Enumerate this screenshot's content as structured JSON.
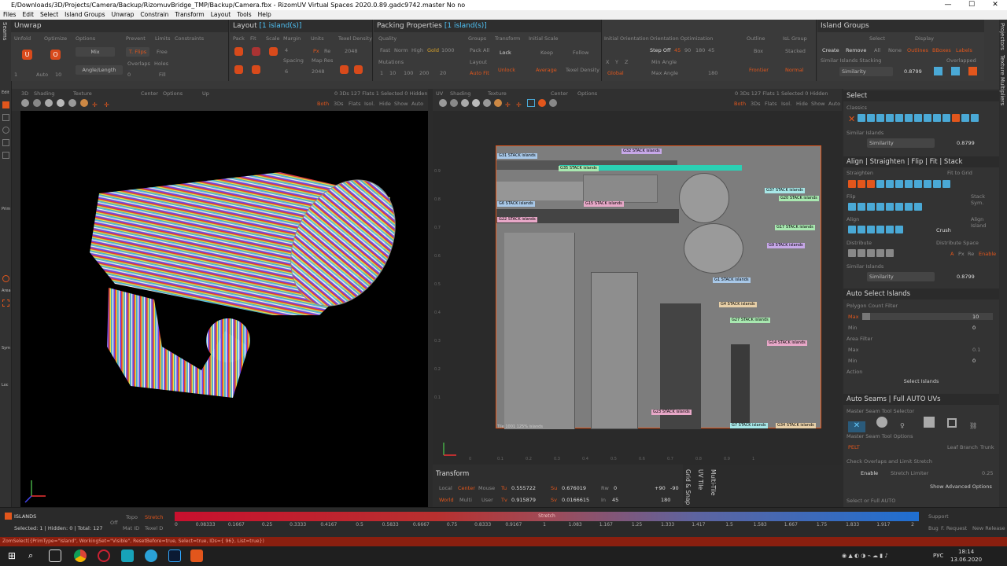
{
  "window": {
    "title": "E/Downloads/3D/Projects/Camera/Backup/RizomuvBridge_TMP/Backup/Camera.fbx - RizomUV  Virtual Spaces 2020.0.89.gadc9742.master No no",
    "min": "—",
    "max": "☐",
    "close": "✕"
  },
  "menu": [
    "Files",
    "Edit",
    "Select",
    "Island Groups",
    "Unwrap",
    "Constrain",
    "Transform",
    "Layout",
    "Tools",
    "Help"
  ],
  "left_strip": {
    "label": "Seams",
    "items": [
      "Edit",
      "Prim",
      "Area",
      "Sym",
      "Loc"
    ]
  },
  "unwrap": {
    "title": "Unwrap",
    "subs": [
      "Unfold",
      "Optimize",
      "Options",
      "Prevent",
      "Limits",
      "Constraints"
    ],
    "mix": "Mix",
    "tflips": "T. Flips",
    "free": "Free",
    "overlaps": "Overlaps",
    "holes": "Holes",
    "fill": "Fill",
    "angle_length": "Angle/Length",
    "auto": "Auto",
    "num1": "1",
    "num10": "10",
    "num0": "0"
  },
  "layout": {
    "title": "Layout",
    "title_hl": "[1 island(s)]",
    "subs": [
      "Pack",
      "Fit",
      "Scale",
      "Margin",
      "Units",
      "Texel Density"
    ],
    "spacing": "Spacing",
    "map_res": "Map Res",
    "margin_val": "4",
    "spacing_val": "6",
    "texel": "2048",
    "map_res_val": "2048",
    "px": "Px",
    "re": "Re"
  },
  "packing": {
    "title": "Packing Properties",
    "title_hl": "[1 island(s)]",
    "subs": [
      "Quality",
      "Groups",
      "Transform",
      "Initial Scale"
    ],
    "quality": [
      "Fast",
      "Norm",
      "High",
      "Gold",
      "1000"
    ],
    "mutations": "Mutations",
    "mut_vals": [
      "1",
      "10",
      "100",
      "200",
      "20"
    ],
    "pack_all": "Pack All",
    "layout_lbl": "Layout",
    "auto_fit": "Auto Fit",
    "lock": "Lock",
    "unlock": "Unlock",
    "keep": "Keep",
    "follow": "Follow",
    "average": "Average",
    "texel_density": "Texel Density"
  },
  "orientation": {
    "subs": [
      "Initial Orientation",
      "Orientation Optimization"
    ],
    "xyz": [
      "X",
      "Y",
      "Z"
    ],
    "step_off": "Step Off",
    "angles": [
      "45",
      "90",
      "180",
      "45"
    ],
    "min_angle": "Min Angle",
    "max_angle": "Max Angle",
    "max_val": "180",
    "global": "Global",
    "outline": "Outline",
    "box": "Box",
    "frontier": "Frontier",
    "isl_group": "IsL Group",
    "stacked": "Stacked",
    "normal": "Normal"
  },
  "island_groups": {
    "title": "Island Groups",
    "subs": [
      "Select",
      "Display"
    ],
    "btns": [
      "Create",
      "Remove",
      "All",
      "None",
      "Outlines",
      "BBoxes",
      "Labels"
    ],
    "similar": "Similar Islands Stacking",
    "overlapped": "Overlapped",
    "similarity": "Similarity",
    "sim_val": "0.8799"
  },
  "vp3d": {
    "items": [
      "3D",
      "Shading",
      "Texture",
      "Center",
      "Options",
      "Up"
    ],
    "stats": "0 3Ds 127 Flats  1 Selected  0 Hidden",
    "modes": [
      "Both",
      "3Ds",
      "Flats",
      "Isol.",
      "Hide",
      "Show",
      "Auto"
    ]
  },
  "uv": {
    "items": [
      "UV",
      "Shading",
      "Texture",
      "Center",
      "Options"
    ],
    "stats": "0 3Ds 127 Flats  1 Selected  0 Hidden",
    "modes": [
      "Both",
      "3Ds",
      "Flats",
      "Isol.",
      "Hide",
      "Show",
      "Auto"
    ],
    "tile_label": "Tile 1001 125%  islands",
    "ticks_y": [
      "0.9",
      "0.8",
      "0.7",
      "0.6",
      "0.5",
      "0.4",
      "0.3",
      "0.2",
      "0.1"
    ],
    "ticks_x": [
      "0",
      "0.1",
      "0.2",
      "0.3",
      "0.4",
      "0.5",
      "0.6",
      "0.7",
      "0.8",
      "0.9",
      "1"
    ],
    "tags": [
      "G32 STACK  islands",
      "G31 STACK  islands",
      "G35 STACK  islands",
      "G6 STACK  islands",
      "G15 STACK  islands",
      "G22 STACK  islands",
      "G37 STACK  islands",
      "G20 STACK  islands",
      "G17 STACK  islands",
      "G9 STACK  islands",
      "G1 STACK  islands",
      "G4 STACK  islands",
      "G27 STACK  islands",
      "G14 STACK  islands",
      "G23 STACK  islands",
      "G7 STACK  islands",
      "G34 STACK  islands"
    ]
  },
  "right": {
    "select": {
      "title": "Select",
      "classics": "Classics",
      "similar": "Similar Islands",
      "similarity": "Similarity",
      "sim_val": "0.8799"
    },
    "align": {
      "title": "Align | Straighten | Flip | Fit | Stack",
      "straighten": "Straighten",
      "fit_to_grid": "Fit to Grid",
      "flip": "Flip",
      "stack_sym": "Stack Sym.",
      "align": "Align",
      "align_island": "Align Island",
      "crush": "Crush",
      "distribute": "Distribute",
      "distribute_space": "Distribute Space",
      "a": "A",
      "px": "Px",
      "re": "Re",
      "enable": "Enable",
      "similar": "Similar Islands",
      "similarity": "Similarity",
      "sim_val": "0.8799"
    },
    "auto_select": {
      "title": "Auto Select Islands",
      "poly_filter": "Polygon Count Filter",
      "max": "Max",
      "max_val": "10",
      "min": "Min",
      "min_val": "0",
      "area_filter": "Area Filter",
      "area_max": "Max",
      "area_max_val": "0.1",
      "area_min": "Min",
      "area_min_val": "0",
      "action": "Action",
      "select_btn": "Select Islands"
    },
    "auto_seams": {
      "title": "Auto Seams | Full AUTO UVs",
      "master": "Master Seam Tool Selector",
      "options": "Master Seam Tool Options",
      "pelt": "PELT",
      "leaf": "Leaf",
      "branch": "Branch",
      "trunk": "Trunk",
      "check": "Check Overlaps and Limit Stretch",
      "enable": "Enable",
      "stretch_limiter": "Stretch Limiter",
      "stretch_val": "0.25",
      "advanced": "Show Advanced Options",
      "select_or_full": "Select or Full AUTO"
    }
  },
  "right_strip": [
    "Projectors",
    "Texture Multipliers"
  ],
  "transform": {
    "title": "Transform",
    "local": "Local",
    "center": "Center",
    "mouse": "Mouse",
    "world": "World",
    "multi": "Multi",
    "user": "User",
    "tu": "Tu",
    "tu_val": "0.555722",
    "tv": "Tv",
    "tv_val": "0.915879",
    "su": "Su",
    "su_val": "0.676019",
    "sv": "Sv",
    "sv_val": "0.0166615",
    "rw": "Rw",
    "rw_val": "0",
    "in": "In",
    "in_val": "45",
    "rot1": "+90",
    "rot2": "-90",
    "rot3": "180",
    "tabs": [
      "Grid & Snap",
      "UV Tile",
      "Multi-Tile"
    ]
  },
  "bottom": {
    "islands": "ISLANDS",
    "selected": "Selected: 1 | Hidden: 0 | Total: 127",
    "off": "Off",
    "topo": "Topo",
    "stretch_btn": "Stretch",
    "mat_id": "Mat ID",
    "texel_d": "Texel D",
    "stretch": "Stretch",
    "support": "Support",
    "ticks": [
      "0",
      "0.08333",
      "0.1667",
      "0.25",
      "0.3333",
      "0.4167",
      "0.5",
      "0.5833",
      "0.6667",
      "0.75",
      "0.8333",
      "0.9167",
      "1",
      "1.083",
      "1.167",
      "1.25",
      "1.333",
      "1.417",
      "1.5",
      "1.583",
      "1.667",
      "1.75",
      "1.833",
      "1.917",
      "2"
    ],
    "links": [
      "Bug",
      "F. Request",
      "New Release"
    ]
  },
  "script": "ZomSelect({PrimType=\"Island\", WorkingSet=\"Visible\", ResetBefore=true, Select=true, IDs={ 96}, List=true})",
  "taskbar": {
    "lang": "РУС",
    "time": "18:14",
    "date": "13.06.2020"
  }
}
